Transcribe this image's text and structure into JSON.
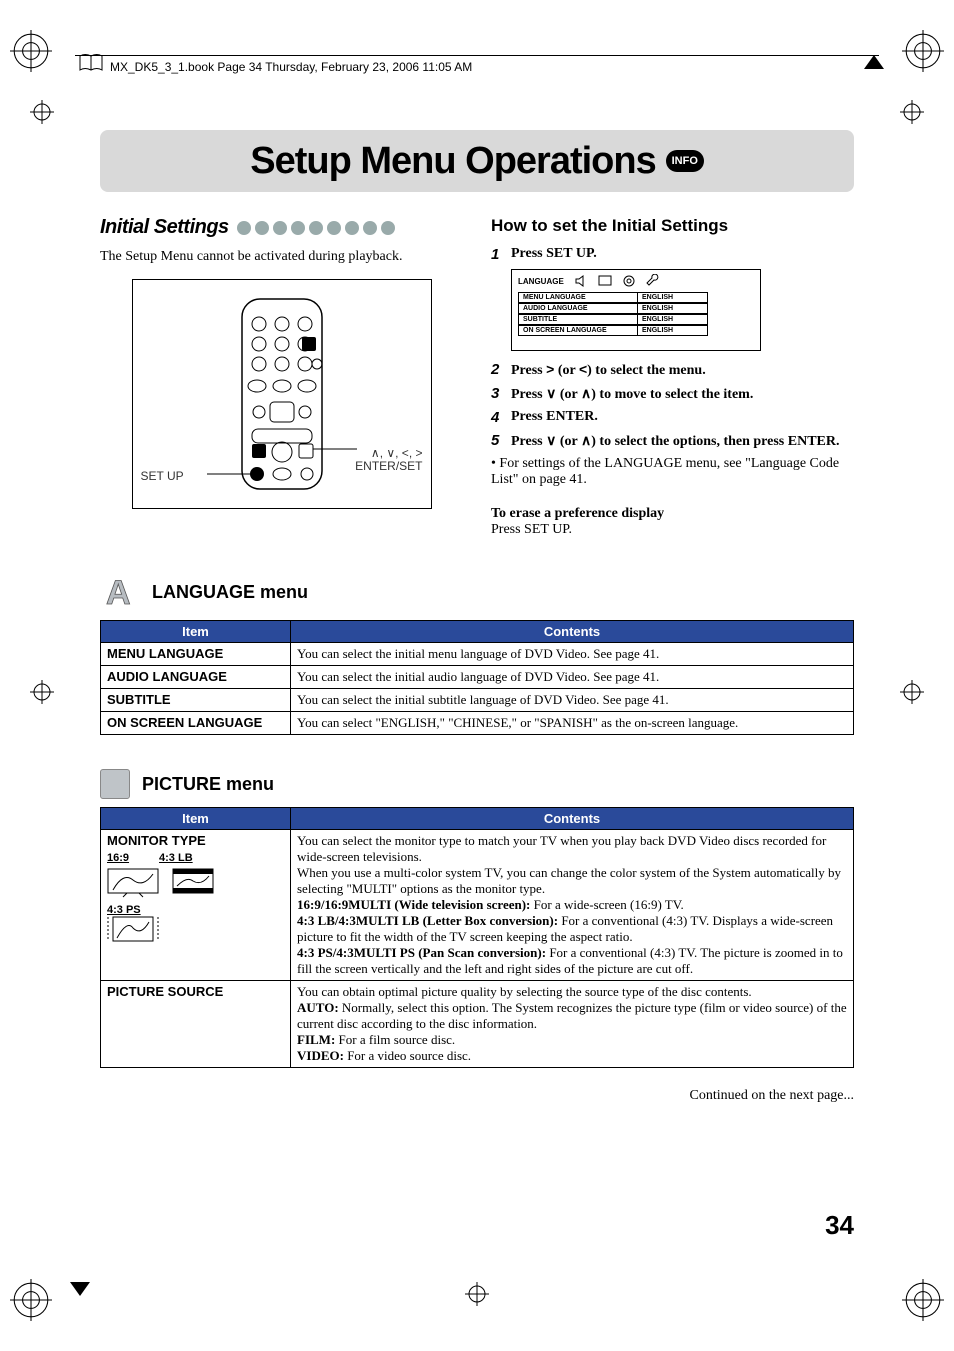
{
  "book_caption": "MX_DK5_3_1.book  Page 34  Thursday, February 23, 2006  11:05 AM",
  "title": "Setup Menu Operations",
  "info_badge": "INFO",
  "initial_settings": {
    "label": "Initial Settings",
    "lead": "The Setup Menu cannot be activated during playback.",
    "remote_label_left": "SET UP",
    "remote_label_right_line1": "∧, ∨, <, >",
    "remote_label_right_line2": "ENTER/SET"
  },
  "how_to": {
    "heading": "How to set the Initial Settings",
    "steps": {
      "s1": "Press SET UP.",
      "s2_a": "Press ",
      "s2_b": " (or ",
      "s2_c": ") to select the menu.",
      "s3_a": "Press ",
      "s3_b": " (or ",
      "s3_c": ") to move to select the item.",
      "s4": "Press ENTER.",
      "s5_a": "Press ",
      "s5_b": " (or ",
      "s5_c": ")  to select the options, then press ENTER."
    },
    "note": "• For settings of the LANGUAGE menu, see \"Language Code List\" on page 41.",
    "erase_head": "To erase a preference display",
    "erase_body": "Press SET UP."
  },
  "onscreen": {
    "tab": "LANGUAGE",
    "rows": [
      {
        "k": "MENU LANGUAGE",
        "v": "ENGLISH"
      },
      {
        "k": "AUDIO LANGUAGE",
        "v": "ENGLISH"
      },
      {
        "k": "SUBTITLE",
        "v": "ENGLISH"
      },
      {
        "k": "ON SCREEN LANGUAGE",
        "v": "ENGLISH"
      }
    ]
  },
  "language_menu": {
    "heading": "LANGUAGE menu",
    "th_item": "Item",
    "th_contents": "Contents",
    "rows": [
      {
        "item": "MENU LANGUAGE",
        "contents": "You can select the initial menu language of DVD Video. See page 41."
      },
      {
        "item": "AUDIO LANGUAGE",
        "contents": "You can select the initial audio language of DVD Video. See page 41."
      },
      {
        "item": "SUBTITLE",
        "contents": "You can select the initial subtitle language of DVD Video. See page 41."
      },
      {
        "item": "ON SCREEN LANGUAGE",
        "contents": "You can select \"ENGLISH,\" \"CHINESE,\" or \"SPANISH\" as the on-screen language."
      }
    ]
  },
  "picture_menu": {
    "heading": "PICTURE menu",
    "th_item": "Item",
    "th_contents": "Contents",
    "monitor_item": "MONITOR TYPE",
    "monitor_options": {
      "a": "16:9",
      "b": "4:3 LB",
      "c": "4:3 PS"
    },
    "monitor_contents": {
      "p1": "You can select the monitor type to match your TV when you play back DVD Video discs recorded for wide-screen televisions.",
      "p2": "When you use a multi-color system TV, you can change the color system of the System automatically by selecting \"MULTI\" options as the monitor type.",
      "l1b": "16:9/16:9MULTI (Wide television screen):",
      "l1": " For a wide-screen (16:9) TV.",
      "l2b": "4:3 LB/4:3MULTI LB (Letter Box conversion):",
      "l2": " For a conventional (4:3) TV. Displays a wide-screen picture to fit the width of the TV screen keeping the aspect ratio.",
      "l3b": "4:3 PS/4:3MULTI PS (Pan Scan conversion):",
      "l3": " For a conventional (4:3) TV. The picture is zoomed in to fill the screen vertically and the left and right sides of the picture are cut off."
    },
    "picture_source_item": "PICTURE SOURCE",
    "picture_source_contents": {
      "p1": "You can obtain optimal picture quality by selecting the source type of the disc contents.",
      "auto_b": "AUTO:",
      "auto": " Normally, select this option. The System recognizes the picture type (film or video source) of the current disc according to the disc information.",
      "film_b": "FILM:",
      "film": " For a film source disc.",
      "video_b": "VIDEO:",
      "video": " For a video source disc."
    }
  },
  "continued": "Continued on the next page...",
  "page_number": "34"
}
